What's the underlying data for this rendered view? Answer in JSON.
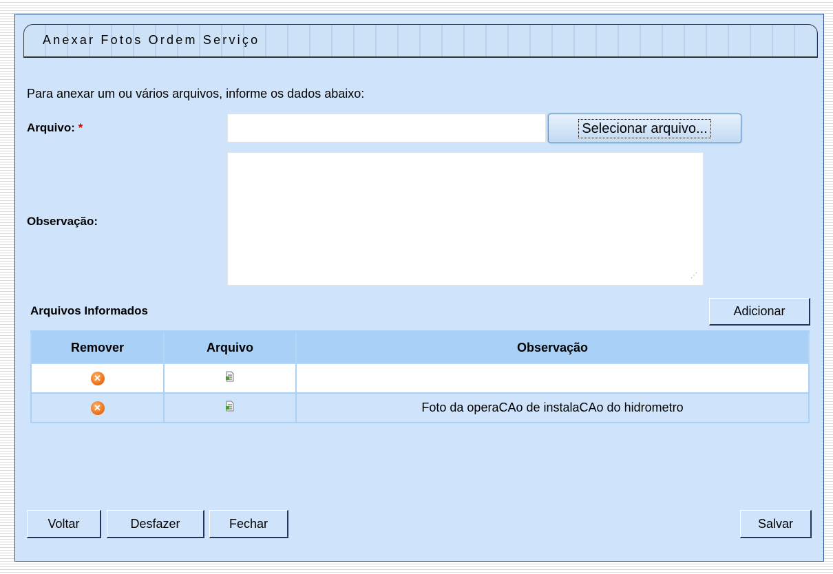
{
  "page": {
    "title": "Anexar Fotos Ordem Serviço",
    "instructions": "Para anexar um ou vários arquivos, informe os dados abaixo:"
  },
  "form": {
    "file_label": "Arquivo:",
    "required_marker": "*",
    "file_value": "",
    "select_button": "Selecionar arquivo...",
    "observation_label": "Observação:",
    "observation_value": ""
  },
  "files_section": {
    "title": "Arquivos Informados",
    "add_button": "Adicionar",
    "columns": [
      "Remover",
      "Arquivo",
      "Observação"
    ],
    "rows": [
      {
        "remove_icon": "remove-circle-icon",
        "file_icon": "document-icon",
        "observation": ""
      },
      {
        "remove_icon": "remove-circle-icon",
        "file_icon": "document-icon",
        "observation": "Foto da operaCAo de instalaCAo do hidrometro"
      }
    ]
  },
  "footer": {
    "back": "Voltar",
    "undo": "Desfazer",
    "close": "Fechar",
    "save": "Salvar"
  },
  "colors": {
    "panel_bg": "#cfe4fb",
    "table_header_bg": "#a9d1f7",
    "remove_icon": "#ea6a10",
    "required": "#cc0000"
  }
}
